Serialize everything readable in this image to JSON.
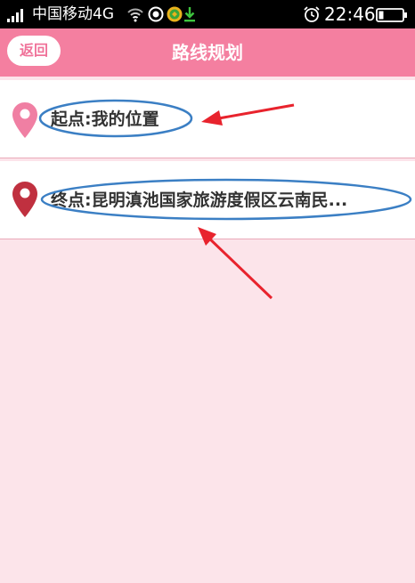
{
  "status_bar": {
    "carrier": "中国移动4G",
    "time": "22:46"
  },
  "header": {
    "back_label": "返回",
    "title": "路线规划"
  },
  "route": {
    "start_label": "起点:我的位置",
    "end_label": "终点:昆明滇池国家旅游度假区云南民..."
  },
  "colors": {
    "header_bg": "#f47fa0",
    "page_bg": "#fce4ea",
    "start_pin": "#f07fa3",
    "end_pin": "#c0303f",
    "annotation_ellipse": "#3b7fc4",
    "annotation_arrow": "#e8232d"
  },
  "icons": [
    "signal-icon",
    "wifi-icon",
    "locate-icon",
    "green-app-icon",
    "download-icon",
    "alarm-icon",
    "battery-icon",
    "map-pin-icon"
  ]
}
